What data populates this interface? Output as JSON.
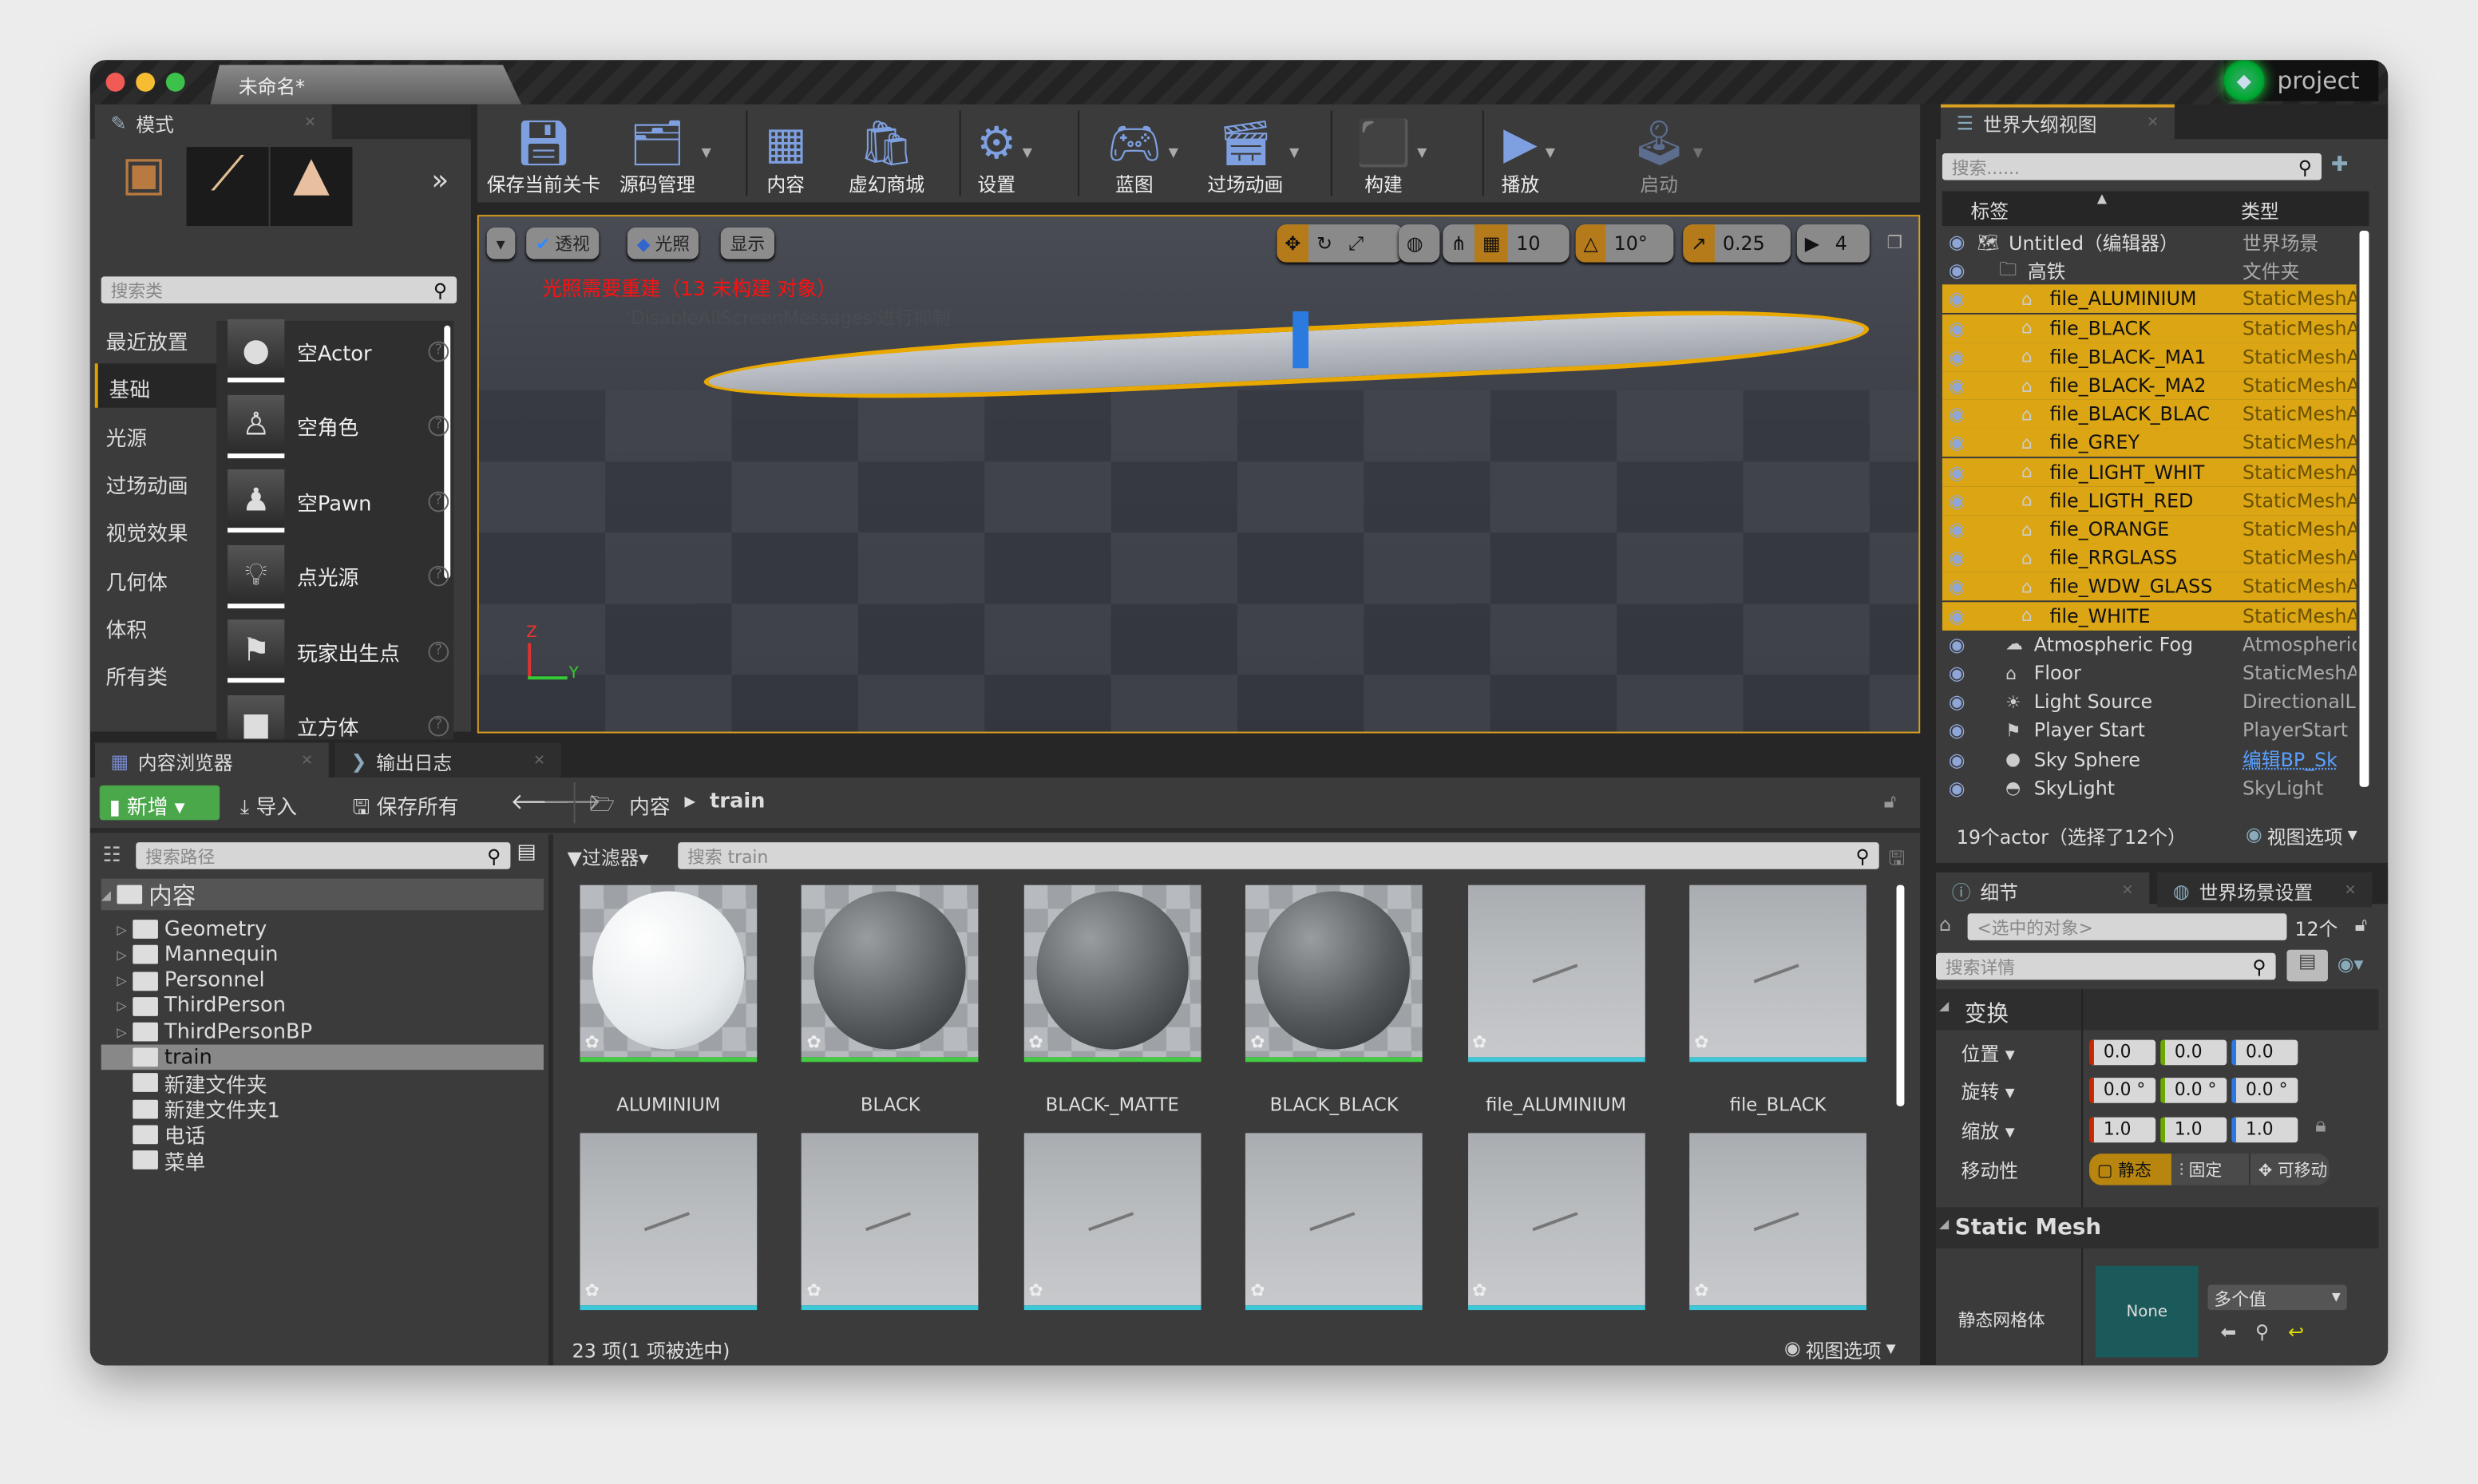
{
  "window": {
    "tab_title": "未命名*",
    "project": "project"
  },
  "modes": {
    "tab": "模式",
    "search_placeholder": "搜索类",
    "categories": [
      "最近放置",
      "基础",
      "光源",
      "过场动画",
      "视觉效果",
      "几何体",
      "体积",
      "所有类"
    ],
    "selected_category": "基础",
    "items": [
      {
        "label": "空Actor",
        "icon": "sphere"
      },
      {
        "label": "空角色",
        "icon": "mannequin"
      },
      {
        "label": "空Pawn",
        "icon": "pawn"
      },
      {
        "label": "点光源",
        "icon": "bulb"
      },
      {
        "label": "玩家出生点",
        "icon": "player-start"
      },
      {
        "label": "立方体",
        "icon": "cube"
      }
    ]
  },
  "toolbar": {
    "buttons": [
      "保存当前关卡",
      "源码管理",
      "内容",
      "虚幻商城",
      "设置",
      "蓝图",
      "过场动画",
      "构建",
      "播放",
      "启动"
    ]
  },
  "viewport": {
    "perspective": "透视",
    "lighting": "光照",
    "show": "显示",
    "warning": "光照需要重建（13 未构建 对象）",
    "suppress_msg": "'DisableAllScreenMessages'进行抑制",
    "grid_snap": "10",
    "rotation_snap": "10°",
    "scale_snap": "0.25",
    "camera_speed": "4",
    "axis_z": "Z",
    "axis_y": "Y"
  },
  "outliner": {
    "tab": "世界大纲视图",
    "search_placeholder": "搜索......",
    "col_label": "标签",
    "col_type": "类型",
    "rows": [
      {
        "name": "Untitled（编辑器）",
        "type": "世界场景",
        "indent": 0,
        "icon": "world",
        "selected": false
      },
      {
        "name": "高铁",
        "type": "文件夹",
        "indent": 1,
        "icon": "folder",
        "selected": false
      },
      {
        "name": "file_ALUMINIUM",
        "type": "StaticMeshA",
        "indent": 2,
        "icon": "mesh",
        "selected": true
      },
      {
        "name": "file_BLACK",
        "type": "StaticMeshA",
        "indent": 2,
        "icon": "mesh",
        "selected": true
      },
      {
        "name": "file_BLACK-_MA1",
        "type": "StaticMeshA",
        "indent": 2,
        "icon": "mesh",
        "selected": true
      },
      {
        "name": "file_BLACK-_MA2",
        "type": "StaticMeshA",
        "indent": 2,
        "icon": "mesh",
        "selected": true
      },
      {
        "name": "file_BLACK_BLAC",
        "type": "StaticMeshA",
        "indent": 2,
        "icon": "mesh",
        "selected": true
      },
      {
        "name": "file_GREY",
        "type": "StaticMeshA",
        "indent": 2,
        "icon": "mesh",
        "selected": true
      },
      {
        "name": "file_LIGHT_WHIT",
        "type": "StaticMeshA",
        "indent": 2,
        "icon": "mesh",
        "selected": true
      },
      {
        "name": "file_LIGTH_RED",
        "type": "StaticMeshA",
        "indent": 2,
        "icon": "mesh",
        "selected": true
      },
      {
        "name": "file_ORANGE",
        "type": "StaticMeshA",
        "indent": 2,
        "icon": "mesh",
        "selected": true
      },
      {
        "name": "file_RRGLASS",
        "type": "StaticMeshA",
        "indent": 2,
        "icon": "mesh",
        "selected": true
      },
      {
        "name": "file_WDW_GLASS",
        "type": "StaticMeshA",
        "indent": 2,
        "icon": "mesh",
        "selected": true
      },
      {
        "name": "file_WHITE",
        "type": "StaticMeshA",
        "indent": 2,
        "icon": "mesh",
        "selected": true
      },
      {
        "name": "Atmospheric Fog",
        "type": "Atmospheric",
        "indent": 1,
        "icon": "fog",
        "selected": false
      },
      {
        "name": "Floor",
        "type": "StaticMeshA",
        "indent": 1,
        "icon": "mesh",
        "selected": false
      },
      {
        "name": "Light Source",
        "type": "DirectionalLi",
        "indent": 1,
        "icon": "sun",
        "selected": false
      },
      {
        "name": "Player Start",
        "type": "PlayerStart",
        "indent": 1,
        "icon": "player-start",
        "selected": false
      },
      {
        "name": "Sky Sphere",
        "type": "编辑BP_Sk",
        "indent": 1,
        "icon": "sphere",
        "selected": false,
        "link": true
      },
      {
        "name": "SkyLight",
        "type": "SkyLight",
        "indent": 1,
        "icon": "skylight",
        "selected": false
      }
    ],
    "footer": "19个actor（选择了12个）",
    "view_options": "视图选项"
  },
  "details": {
    "tab": "细节",
    "tab2": "世界场景设置",
    "selected_placeholder": "<选中的对象>",
    "count": "12个",
    "search_placeholder": "搜索详情",
    "transform_header": "变换",
    "location_label": "位置",
    "location": [
      "0.0",
      "0.0",
      "0.0"
    ],
    "rotation_label": "旋转",
    "rotation": [
      "0.0 °",
      "0.0 °",
      "0.0 °"
    ],
    "scale_label": "缩放",
    "scale": [
      "1.0",
      "1.0",
      "1.0"
    ],
    "mobility_label": "移动性",
    "mobility": [
      "静态",
      "固定",
      "可移动"
    ],
    "mobility_selected": "静态",
    "static_mesh_header": "Static Mesh",
    "static_mesh_label": "静态网格体",
    "mesh_thumb": "None",
    "mesh_value": "多个值"
  },
  "content": {
    "tab": "内容浏览器",
    "tab2": "输出日志",
    "new_label": "新增",
    "import_label": "导入",
    "save_all_label": "保存所有",
    "breadcrumb": [
      "内容",
      "train"
    ],
    "path_search_placeholder": "搜索路径",
    "filter_label": "过滤器",
    "search_placeholder": "搜索 train",
    "tree": [
      {
        "label": "内容",
        "root": true
      },
      {
        "label": "Geometry",
        "expandable": true
      },
      {
        "label": "Mannequin",
        "expandable": true
      },
      {
        "label": "Personnel",
        "expandable": true
      },
      {
        "label": "ThirdPerson",
        "expandable": true
      },
      {
        "label": "ThirdPersonBP",
        "expandable": true
      },
      {
        "label": "train",
        "selected": true
      },
      {
        "label": "新建文件夹"
      },
      {
        "label": "新建文件夹1"
      },
      {
        "label": "电话"
      },
      {
        "label": "菜单"
      }
    ],
    "assets": [
      {
        "name": "ALUMINIUM",
        "kind": "material",
        "color": "#f2f4f5"
      },
      {
        "name": "BLACK",
        "kind": "material",
        "color": "#5a5d60"
      },
      {
        "name": "BLACK-_MATTE",
        "kind": "material",
        "color": "#5a5d60"
      },
      {
        "name": "BLACK_BLACK",
        "kind": "material",
        "color": "#55585b"
      },
      {
        "name": "file_ALUMINIUM",
        "kind": "mesh"
      },
      {
        "name": "file_BLACK",
        "kind": "mesh"
      },
      {
        "name": "",
        "kind": "mesh"
      },
      {
        "name": "",
        "kind": "mesh"
      },
      {
        "name": "",
        "kind": "mesh"
      },
      {
        "name": "",
        "kind": "mesh"
      },
      {
        "name": "",
        "kind": "mesh"
      },
      {
        "name": "",
        "kind": "mesh"
      }
    ],
    "status": "23 项(1 项被选中)",
    "view_options": "视图选项"
  },
  "colors": {
    "selection": "#dba514",
    "accent_green": "#4aa84a",
    "warning": "#ff1010"
  }
}
